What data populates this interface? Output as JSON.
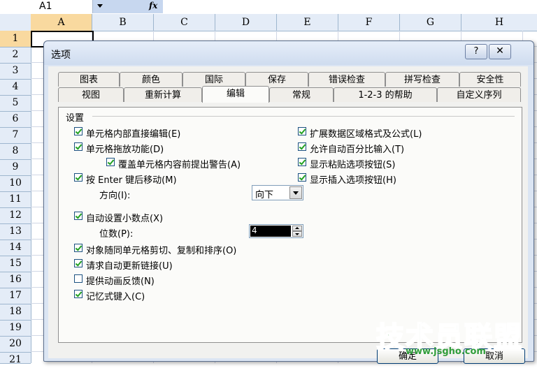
{
  "spreadsheet": {
    "name_box": "A1",
    "fx_label": "fx",
    "columns": [
      "A",
      "B",
      "C",
      "D",
      "E",
      "F",
      "G",
      "H"
    ],
    "rows": [
      "1",
      "2",
      "3",
      "4",
      "5",
      "6",
      "7",
      "8",
      "9",
      "10",
      "11",
      "12",
      "13",
      "14",
      "15",
      "16",
      "17",
      "18",
      "19",
      "20",
      "21"
    ]
  },
  "dialog": {
    "title": "选项",
    "help_button": "?",
    "close_button": "✕",
    "tabs_top": [
      "图表",
      "颜色",
      "国际",
      "保存",
      "错误检查",
      "拼写检查",
      "安全性"
    ],
    "tabs_bottom": [
      "视图",
      "重新计算",
      "编辑",
      "常规",
      "1-2-3 的帮助",
      "自定义序列"
    ],
    "active_tab": "编辑",
    "group_label": "设置",
    "left_options": [
      {
        "label": "单元格内部直接编辑(E)",
        "checked": true
      },
      {
        "label": "单元格拖放功能(D)",
        "checked": true
      },
      {
        "label": "覆盖单元格内容前提出警告(A)",
        "checked": true
      },
      {
        "label": "按 Enter 键后移动(M)",
        "checked": true
      },
      {
        "label": "自动设置小数点(X)",
        "checked": true
      },
      {
        "label": "对象随同单元格剪切、复制和排序(O)",
        "checked": true
      },
      {
        "label": "请求自动更新链接(U)",
        "checked": true
      },
      {
        "label": "提供动画反馈(N)",
        "checked": false
      },
      {
        "label": "记忆式键入(C)",
        "checked": true
      }
    ],
    "right_options": [
      {
        "label": "扩展数据区域格式及公式(L)",
        "checked": true
      },
      {
        "label": "允许自动百分比输入(T)",
        "checked": true
      },
      {
        "label": "显示粘贴选项按钮(S)",
        "checked": true
      },
      {
        "label": "显示插入选项按钮(H)",
        "checked": true
      }
    ],
    "direction_label": "方向(I):",
    "direction_value": "向下",
    "places_label": "位数(P):",
    "places_value": "4",
    "ok_button": "确定",
    "cancel_button": "取消"
  },
  "watermark": {
    "title": "技术员联盟",
    "url": "www.jsgho.com"
  }
}
